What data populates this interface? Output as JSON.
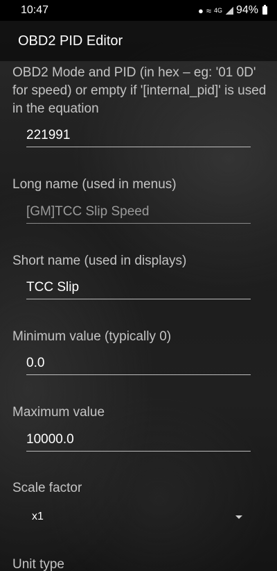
{
  "status_bar": {
    "time": "10:47",
    "network": "4G",
    "battery": "94%"
  },
  "app_bar": {
    "title": "OBD2 PID Editor"
  },
  "form": {
    "pid": {
      "label": "OBD2 Mode and PID (in hex – eg: '01 0D' for speed) or empty if '[internal_pid]' is used in the equation",
      "value": "221991"
    },
    "long_name": {
      "label": "Long name (used in menus)",
      "value": "[GM]TCC Slip Speed"
    },
    "short_name": {
      "label": "Short name (used in displays)",
      "value": "TCC Slip"
    },
    "min_value": {
      "label": "Minimum value (typically 0)",
      "value": "0.0"
    },
    "max_value": {
      "label": "Maximum value",
      "value": "10000.0"
    },
    "scale_factor": {
      "label": "Scale factor",
      "selected": "x1"
    },
    "unit_type": {
      "label": "Unit type"
    }
  },
  "icons": {
    "location": "location-icon",
    "wifi": "wifi-icon",
    "signal": "signal-icon",
    "battery": "battery-icon",
    "dropdown": "chevron-down-icon"
  }
}
